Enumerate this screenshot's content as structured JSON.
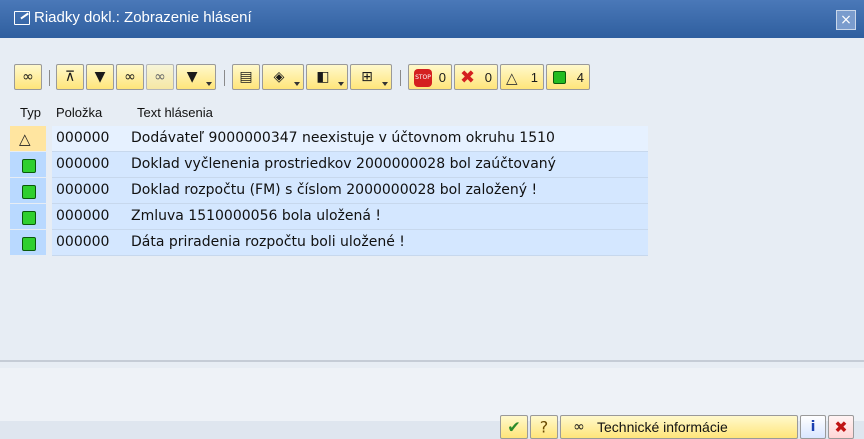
{
  "window": {
    "title": "Riadky dokl.: Zobrazenie hlásení",
    "close": "×"
  },
  "toolbar": {
    "counts": {
      "stop": "0",
      "error": "0",
      "warning": "1",
      "success": "4"
    }
  },
  "table": {
    "headers": {
      "type": "Typ",
      "position": "Položka",
      "text": "Text hlásenia"
    },
    "rows": [
      {
        "type": "warning",
        "position": "000000",
        "text": "Dodávateľ 9000000347 neexistuje v účtovnom okruhu 1510"
      },
      {
        "type": "success",
        "position": "000000",
        "text": "Doklad vyčlenenia prostriedkov 2000000028 bol zaúčtovaný"
      },
      {
        "type": "success",
        "position": "000000",
        "text": "Doklad rozpočtu (FM) s číslom 2000000028 bol založený !"
      },
      {
        "type": "success",
        "position": "000000",
        "text": "Zmluva 1510000056 bola uložená !"
      },
      {
        "type": "success",
        "position": "000000",
        "text": "Dáta priradenia rozpočtu boli uložené !"
      }
    ]
  },
  "footer": {
    "technical_info_label": "Technické informácie"
  },
  "colors": {
    "title_bar": "#2f5f9f",
    "row_bg": "#d4e7ff",
    "button_bg": "#ffe57a",
    "success": "#22bb22",
    "stop": "#d42020"
  }
}
